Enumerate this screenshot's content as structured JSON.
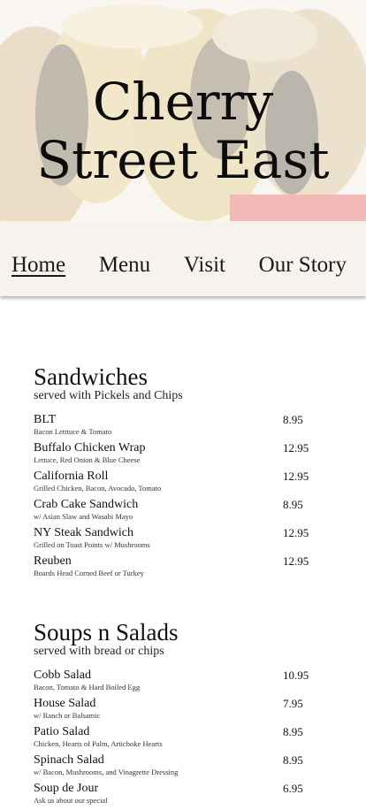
{
  "hero": {
    "title_line1": "Cherry",
    "title_line2": "Street East"
  },
  "nav": {
    "items": [
      {
        "label": "Home",
        "active": true
      },
      {
        "label": "Menu",
        "active": false
      },
      {
        "label": "Visit",
        "active": false
      },
      {
        "label": "Our Story",
        "active": false
      }
    ]
  },
  "sections": [
    {
      "title": "Sandwiches",
      "subtitle": "served with Pickels and Chips",
      "items": [
        {
          "name": "BLT",
          "desc": "Bacon Letttuce & Tomato",
          "price": "8.95"
        },
        {
          "name": "Buffalo Chicken Wrap",
          "desc": "Lettuce, Red Onion & Blue Cheese",
          "price": "12.95"
        },
        {
          "name": "California Roll",
          "desc": "Grilled Chicken, Bacon, Avocado, Tomato",
          "price": "12.95"
        },
        {
          "name": "Crab Cake Sandwich",
          "desc": "w/ Asian Slaw and Wasabi Mayo",
          "price": "8.95"
        },
        {
          "name": "NY Steak Sandwich",
          "desc": "Grilled on Toast Points w/ Mushrooms",
          "price": "12.95"
        },
        {
          "name": "Reuben",
          "desc": "Boards Head Corned Beef or Turkey",
          "price": "12.95"
        }
      ]
    },
    {
      "title": "Soups n Salads",
      "subtitle": "served with bread or chips",
      "items": [
        {
          "name": "Cobb Salad",
          "desc": "Bacon, Tomato & Hard Boiled Egg",
          "price": "10.95"
        },
        {
          "name": "House Salad",
          "desc": "w/ Ranch or Balsamic",
          "price": "7.95"
        },
        {
          "name": "Patio Salad",
          "desc": "Chicken, Hearts of Palm, Artichoke Hearts",
          "price": "8.95"
        },
        {
          "name": "Spinach Salad",
          "desc": "w/ Bacon, Mushrooms, and Vinagrette Dressing",
          "price": "8.95"
        },
        {
          "name": "Soup de Jour",
          "desc": "Ask us about our special",
          "price": "6.95"
        }
      ]
    }
  ]
}
